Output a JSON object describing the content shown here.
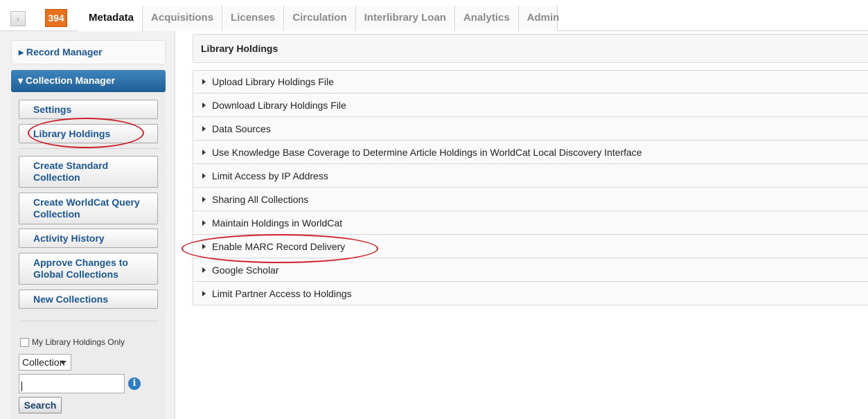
{
  "topnav": {
    "back_icon": "‹",
    "count_badge": "394",
    "tabs": [
      {
        "label": "Metadata",
        "active": true
      },
      {
        "label": "Acquisitions"
      },
      {
        "label": "Licenses"
      },
      {
        "label": "Circulation"
      },
      {
        "label": "Interlibrary Loan"
      },
      {
        "label": "Analytics"
      },
      {
        "label": "Admin"
      }
    ]
  },
  "sidebar": {
    "record_manager": "▸ Record Manager",
    "collection_manager": "▾ Collection Manager",
    "buttons": [
      "Settings",
      "Library Holdings",
      "Create Standard Collection",
      "Create WorldCat Query Collection",
      "Activity History",
      "Approve Changes to Global Collections",
      "New Collections"
    ],
    "checkbox_label": "My Library Holdings Only",
    "select_value": "Collection",
    "search_value": "",
    "info_icon": "i",
    "search_button": "Search"
  },
  "main": {
    "title": "Library Holdings",
    "sections": [
      "Upload Library Holdings File",
      "Download Library Holdings File",
      "Data Sources",
      "Use Knowledge Base Coverage to Determine Article Holdings in WorldCat Local Discovery Interface",
      "Limit Access by IP Address",
      "Sharing All Collections",
      "Maintain Holdings in WorldCat",
      "Enable MARC Record Delivery",
      "Google Scholar",
      "Limit Partner Access to Holdings"
    ]
  },
  "colors": {
    "accent": "#1a5693",
    "badge": "#e8711c",
    "annotation": "#d0212b"
  }
}
